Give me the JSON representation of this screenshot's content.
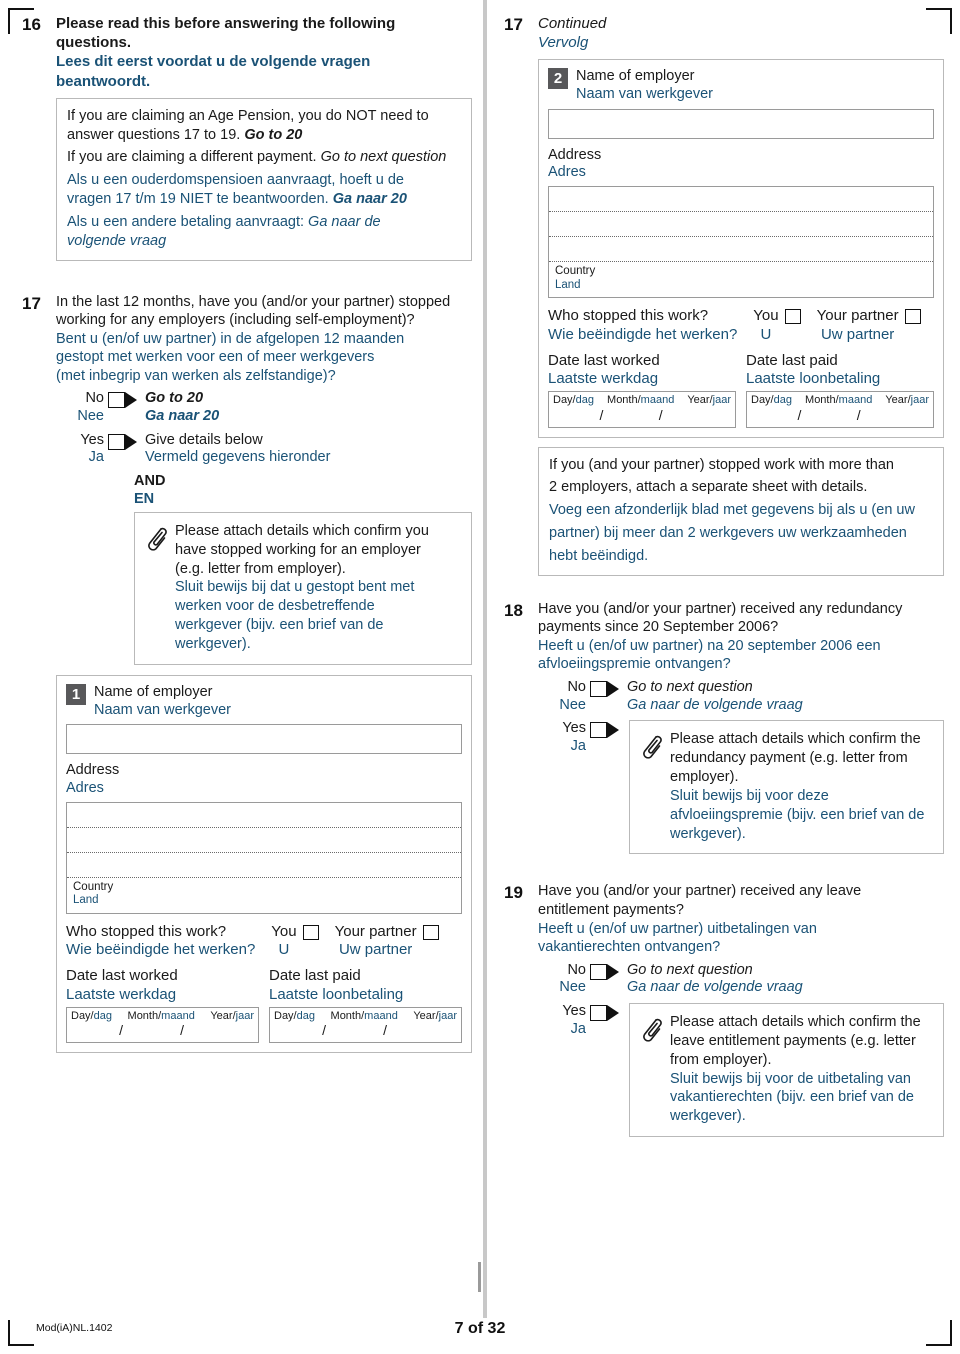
{
  "footer": {
    "form_code": "Mod(iA)NL.1402",
    "page_label": "7 of 32"
  },
  "colors": {
    "dutch_text": "#1a5276",
    "badge_bg": "#58585a",
    "box_border": "#b9b9b9"
  },
  "q16": {
    "number": "16",
    "title_en": "Please read this before answering the following questions.",
    "title_nl_line1": "Lees dit eerst voordat u de volgende vragen",
    "title_nl_line2": "beantwoordt.",
    "note": {
      "en_p1_a": "If you are claiming an Age Pension, you do NOT need to",
      "en_p1_b": "answer questions 17 to 19. ",
      "en_p1_goto": "Go to 20",
      "en_p2_a": "If you are claiming a different payment. ",
      "en_p2_goto": "Go to next question",
      "nl_p1_a": "Als u een ouderdomspensioen aanvraagt, hoeft u de",
      "nl_p1_b": "vragen 17 t/m 19 NIET te beantwoorden. ",
      "nl_p1_goto": "Ga naar 20",
      "nl_p2_a": "Als u een andere betaling aanvraagt: ",
      "nl_p2_goto_a": "Ga naar de",
      "nl_p2_goto_b": "volgende vraag"
    }
  },
  "q17": {
    "number": "17",
    "en_line1": "In the last 12 months, have you (and/or your partner) stopped",
    "en_line2": "working for any employers (including self-employment)?",
    "nl_line1": "Bent u (en/of uw partner) in de afgelopen 12 maanden",
    "nl_line2": "gestopt met werken voor een of meer werkgevers",
    "nl_line3": "(met inbegrip van werken als zelfstandige)?",
    "no_en": "No",
    "no_nl": "Nee",
    "no_action_en": "Go to 20",
    "no_action_nl": "Ga naar 20",
    "yes_en": "Yes",
    "yes_nl": "Ja",
    "yes_action_en": "Give details below",
    "yes_action_nl": "Vermeld gegevens hieronder",
    "and_en": "AND",
    "and_nl": "EN",
    "attach": {
      "en_l1": "Please attach details which confirm you",
      "en_l2": "have stopped working for an employer",
      "en_l3": "(e.g. letter from employer).",
      "nl_l1": "Sluit bewijs bij dat u gestopt bent met",
      "nl_l2": "werken voor de desbetreffende",
      "nl_l3": "werkgever (bijv. een brief van de",
      "nl_l4": "werkgever)."
    },
    "continued_en": "Continued",
    "continued_nl": "Vervolg",
    "more_employers": {
      "en_l1": "If you (and your partner) stopped work with more than",
      "en_l2": "2 employers, attach a separate sheet with details.",
      "nl_l1": "Voeg een afzonderlijk blad met gegevens bij als u (en uw",
      "nl_l2": "partner) bij meer dan 2 werkgevers uw werkzaamheden",
      "nl_l3": "hebt beëindigd."
    }
  },
  "employer_common": {
    "name_en": "Name of employer",
    "name_nl": "Naam van werkgever",
    "address_en": "Address",
    "address_nl": "Adres",
    "country_en": "Country",
    "country_nl": "Land",
    "who_stopped_en": "Who stopped this work?",
    "who_stopped_nl": "Wie beëindigde het werken?",
    "you_en": "You",
    "you_nl": "U",
    "partner_en": "Your partner",
    "partner_nl": "Uw partner",
    "last_worked_en": "Date last worked",
    "last_worked_nl": "Laatste werkdag",
    "last_paid_en": "Date last paid",
    "last_paid_nl": "Laatste loonbetaling",
    "day_en": "Day/",
    "day_nl": "dag",
    "month_en": "Month/",
    "month_nl": "maand",
    "year_en": "Year/",
    "year_nl": "jaar",
    "slash": "/",
    "name_value": "",
    "address_value": "",
    "country_value": ""
  },
  "employer1": {
    "badge": "1"
  },
  "employer2": {
    "badge": "2"
  },
  "q18": {
    "number": "18",
    "en_line1": "Have you (and/or your partner) received any redundancy",
    "en_line2": "payments since 20 September 2006?",
    "nl_line1": "Heeft u (en/of uw partner) na 20 september 2006 een",
    "nl_line2": "afvloeiingspremie ontvangen?",
    "no_en": "No",
    "no_nl": "Nee",
    "no_action_en": "Go to next question",
    "no_action_nl": "Ga naar de volgende vraag",
    "yes_en": "Yes",
    "yes_nl": "Ja",
    "attach": {
      "en_l1": "Please attach details which confirm the",
      "en_l2": "redundancy payment (e.g. letter from",
      "en_l3": "employer).",
      "nl_l1": "Sluit bewijs bij voor deze",
      "nl_l2": "afvloeiingspremie (bijv. een brief van de",
      "nl_l3": "werkgever)."
    }
  },
  "q19": {
    "number": "19",
    "en_line1": "Have you (and/or your partner) received any leave",
    "en_line2": "entitlement payments?",
    "nl_line1": "Heeft u (en/of uw partner) uitbetalingen van",
    "nl_line2": "vakantierechten ontvangen?",
    "no_en": "No",
    "no_nl": "Nee",
    "no_action_en": "Go to next question",
    "no_action_nl": "Ga naar de volgende vraag",
    "yes_en": "Yes",
    "yes_nl": "Ja",
    "attach": {
      "en_l1": "Please attach details which confirm the",
      "en_l2": "leave entitlement payments (e.g. letter",
      "en_l3": "from employer).",
      "nl_l1": "Sluit bewijs bij voor de uitbetaling van",
      "nl_l2": "vakantierechten (bijv. een brief van de",
      "nl_l3": "werkgever)."
    }
  }
}
